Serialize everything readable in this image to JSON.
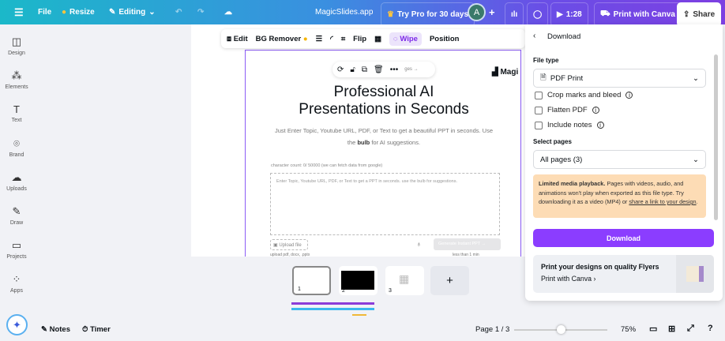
{
  "topbar": {
    "file": "File",
    "resize": "Resize",
    "editing": "Editing",
    "title": "MagicSlides.app",
    "try_pro": "Try Pro for 30 days",
    "avatar": "A",
    "timer": "1:28",
    "print": "Print with Canva",
    "share": "Share"
  },
  "sidebar": [
    {
      "label": "Design",
      "icon": "design-icon"
    },
    {
      "label": "Elements",
      "icon": "elements-icon"
    },
    {
      "label": "Text",
      "icon": "text-icon"
    },
    {
      "label": "Brand",
      "icon": "brand-icon"
    },
    {
      "label": "Uploads",
      "icon": "uploads-icon"
    },
    {
      "label": "Draw",
      "icon": "draw-icon"
    },
    {
      "label": "Projects",
      "icon": "projects-icon"
    },
    {
      "label": "Apps",
      "icon": "apps-icon"
    }
  ],
  "toolbar": {
    "edit": "Edit",
    "bg_remover": "BG Remover",
    "flip": "Flip",
    "wipe": "Wipe",
    "position": "Position"
  },
  "slide": {
    "brand": "Magi",
    "title1": "Professional AI",
    "title2": "Presentations in Seconds",
    "sub1": "Just Enter Topic, Youtube URL, PDF, or Text to get a beautiful PPT in seconds. Use",
    "sub2_pre": "the ",
    "sub2_bold": "bulb",
    "sub2_post": " for AI suggestions.",
    "char_count": "character count: 0/ 50000 (we can fetch data from google)",
    "placeholder": "Enter Topic, Youtube URL, PDF, or Text to get a PPT in seconds. use the bulb for suggestions.",
    "upload": "Upload file",
    "upload_hint": "upload pdf, docx, .pptx",
    "generate": "Generate Instant PPT →",
    "time_hint": "less than 1 min",
    "pages_link": "ges →"
  },
  "panel": {
    "title": "Download",
    "file_type_label": "File type",
    "file_type": "PDF Print",
    "options": [
      "Crop marks and bleed",
      "Flatten PDF",
      "Include notes"
    ],
    "select_pages_label": "Select pages",
    "pages": "All pages (3)",
    "warning_bold": "Limited media playback.",
    "warning_text": " Pages with videos, audio, and animations won't play when exported as this file type. Try downloading it as a video (MP4) or ",
    "warning_link": "share a link to your design",
    "warning_end": ".",
    "download": "Download",
    "promo_title": "Print your designs on quality Flyers",
    "promo_link": "Print with Canva"
  },
  "thumbs": [
    "1",
    "2",
    "3"
  ],
  "bottom": {
    "notes": "Notes",
    "timer": "Timer",
    "page": "Page 1 / 3",
    "zoom": "75%",
    "zoom_level": 75
  },
  "colors": {
    "accent": "#8b3dff",
    "warning_bg": "#fddcb5"
  }
}
